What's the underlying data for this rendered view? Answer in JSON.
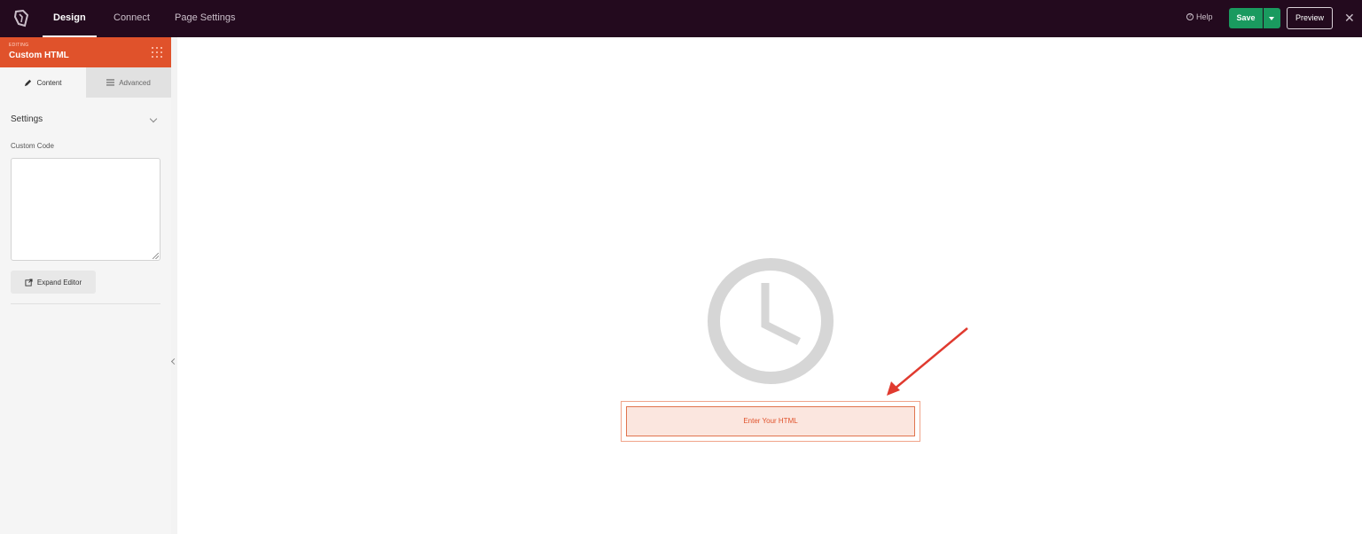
{
  "topbar": {
    "tabs": [
      {
        "label": "Design"
      },
      {
        "label": "Connect"
      },
      {
        "label": "Page Settings"
      }
    ],
    "help_label": "Help",
    "save_label": "Save",
    "preview_label": "Preview"
  },
  "sidebar": {
    "editing_label": "EDITING",
    "editing_title": "Custom HTML",
    "tabs": [
      {
        "label": "Content"
      },
      {
        "label": "Advanced"
      }
    ],
    "settings_header": "Settings",
    "custom_code_label": "Custom Code",
    "custom_code_value": "",
    "expand_editor_label": "Expand Editor"
  },
  "canvas": {
    "placeholder_label": "Enter Your HTML"
  },
  "colors": {
    "topbar_bg": "#230a1e",
    "accent": "#e0522b",
    "save_green": "#1a9a5f",
    "annotation_arrow": "#e03a2f"
  },
  "icons": [
    "logo-icon",
    "help-icon",
    "dropdown-caret-icon",
    "close-icon",
    "grip-icon",
    "pencil-icon",
    "list-icon",
    "chevron-down-icon",
    "external-link-icon",
    "chevron-left-icon",
    "clock-icon",
    "arrow-annotation"
  ]
}
